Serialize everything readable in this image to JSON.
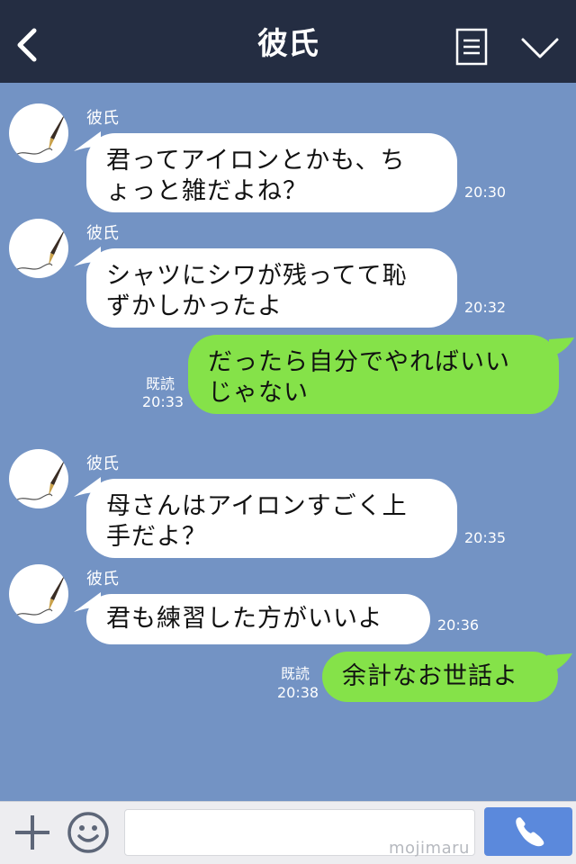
{
  "header": {
    "title": "彼氏",
    "back_icon": "chevron-left-icon",
    "menu_icon": "list-icon",
    "more_icon": "chevron-down-icon",
    "background": "#242d42"
  },
  "colors": {
    "chat_background": "#7393c4",
    "incoming_bubble": "#ffffff",
    "outgoing_bubble": "#85e249",
    "call_button": "#5b89dc"
  },
  "messages": [
    {
      "side": "in",
      "sender": "彼氏",
      "text": "君ってアイロンとかも、ち\nょっと雑だよね？",
      "time": "20:30"
    },
    {
      "side": "in",
      "sender": "彼氏",
      "text": "シャツにシワが残ってて恥\nずかしかったよ",
      "time": "20:32"
    },
    {
      "side": "out",
      "read": "既読",
      "text": "だったら自分でやればいい\nじゃない",
      "time": "20:33"
    },
    {
      "side": "in",
      "sender": "彼氏",
      "text": "母さんはアイロンすごく上\n手だよ？",
      "time": "20:35"
    },
    {
      "side": "in",
      "sender": "彼氏",
      "text": "君も練習した方がいいよ",
      "time": "20:36"
    },
    {
      "side": "out",
      "read": "既読",
      "text": "余計なお世話よ",
      "time": "20:38"
    }
  ],
  "input_bar": {
    "plus_icon": "plus-icon",
    "emoji_icon": "smiley-icon",
    "placeholder": "",
    "watermark": "mojimaru",
    "call_icon": "phone-icon"
  }
}
